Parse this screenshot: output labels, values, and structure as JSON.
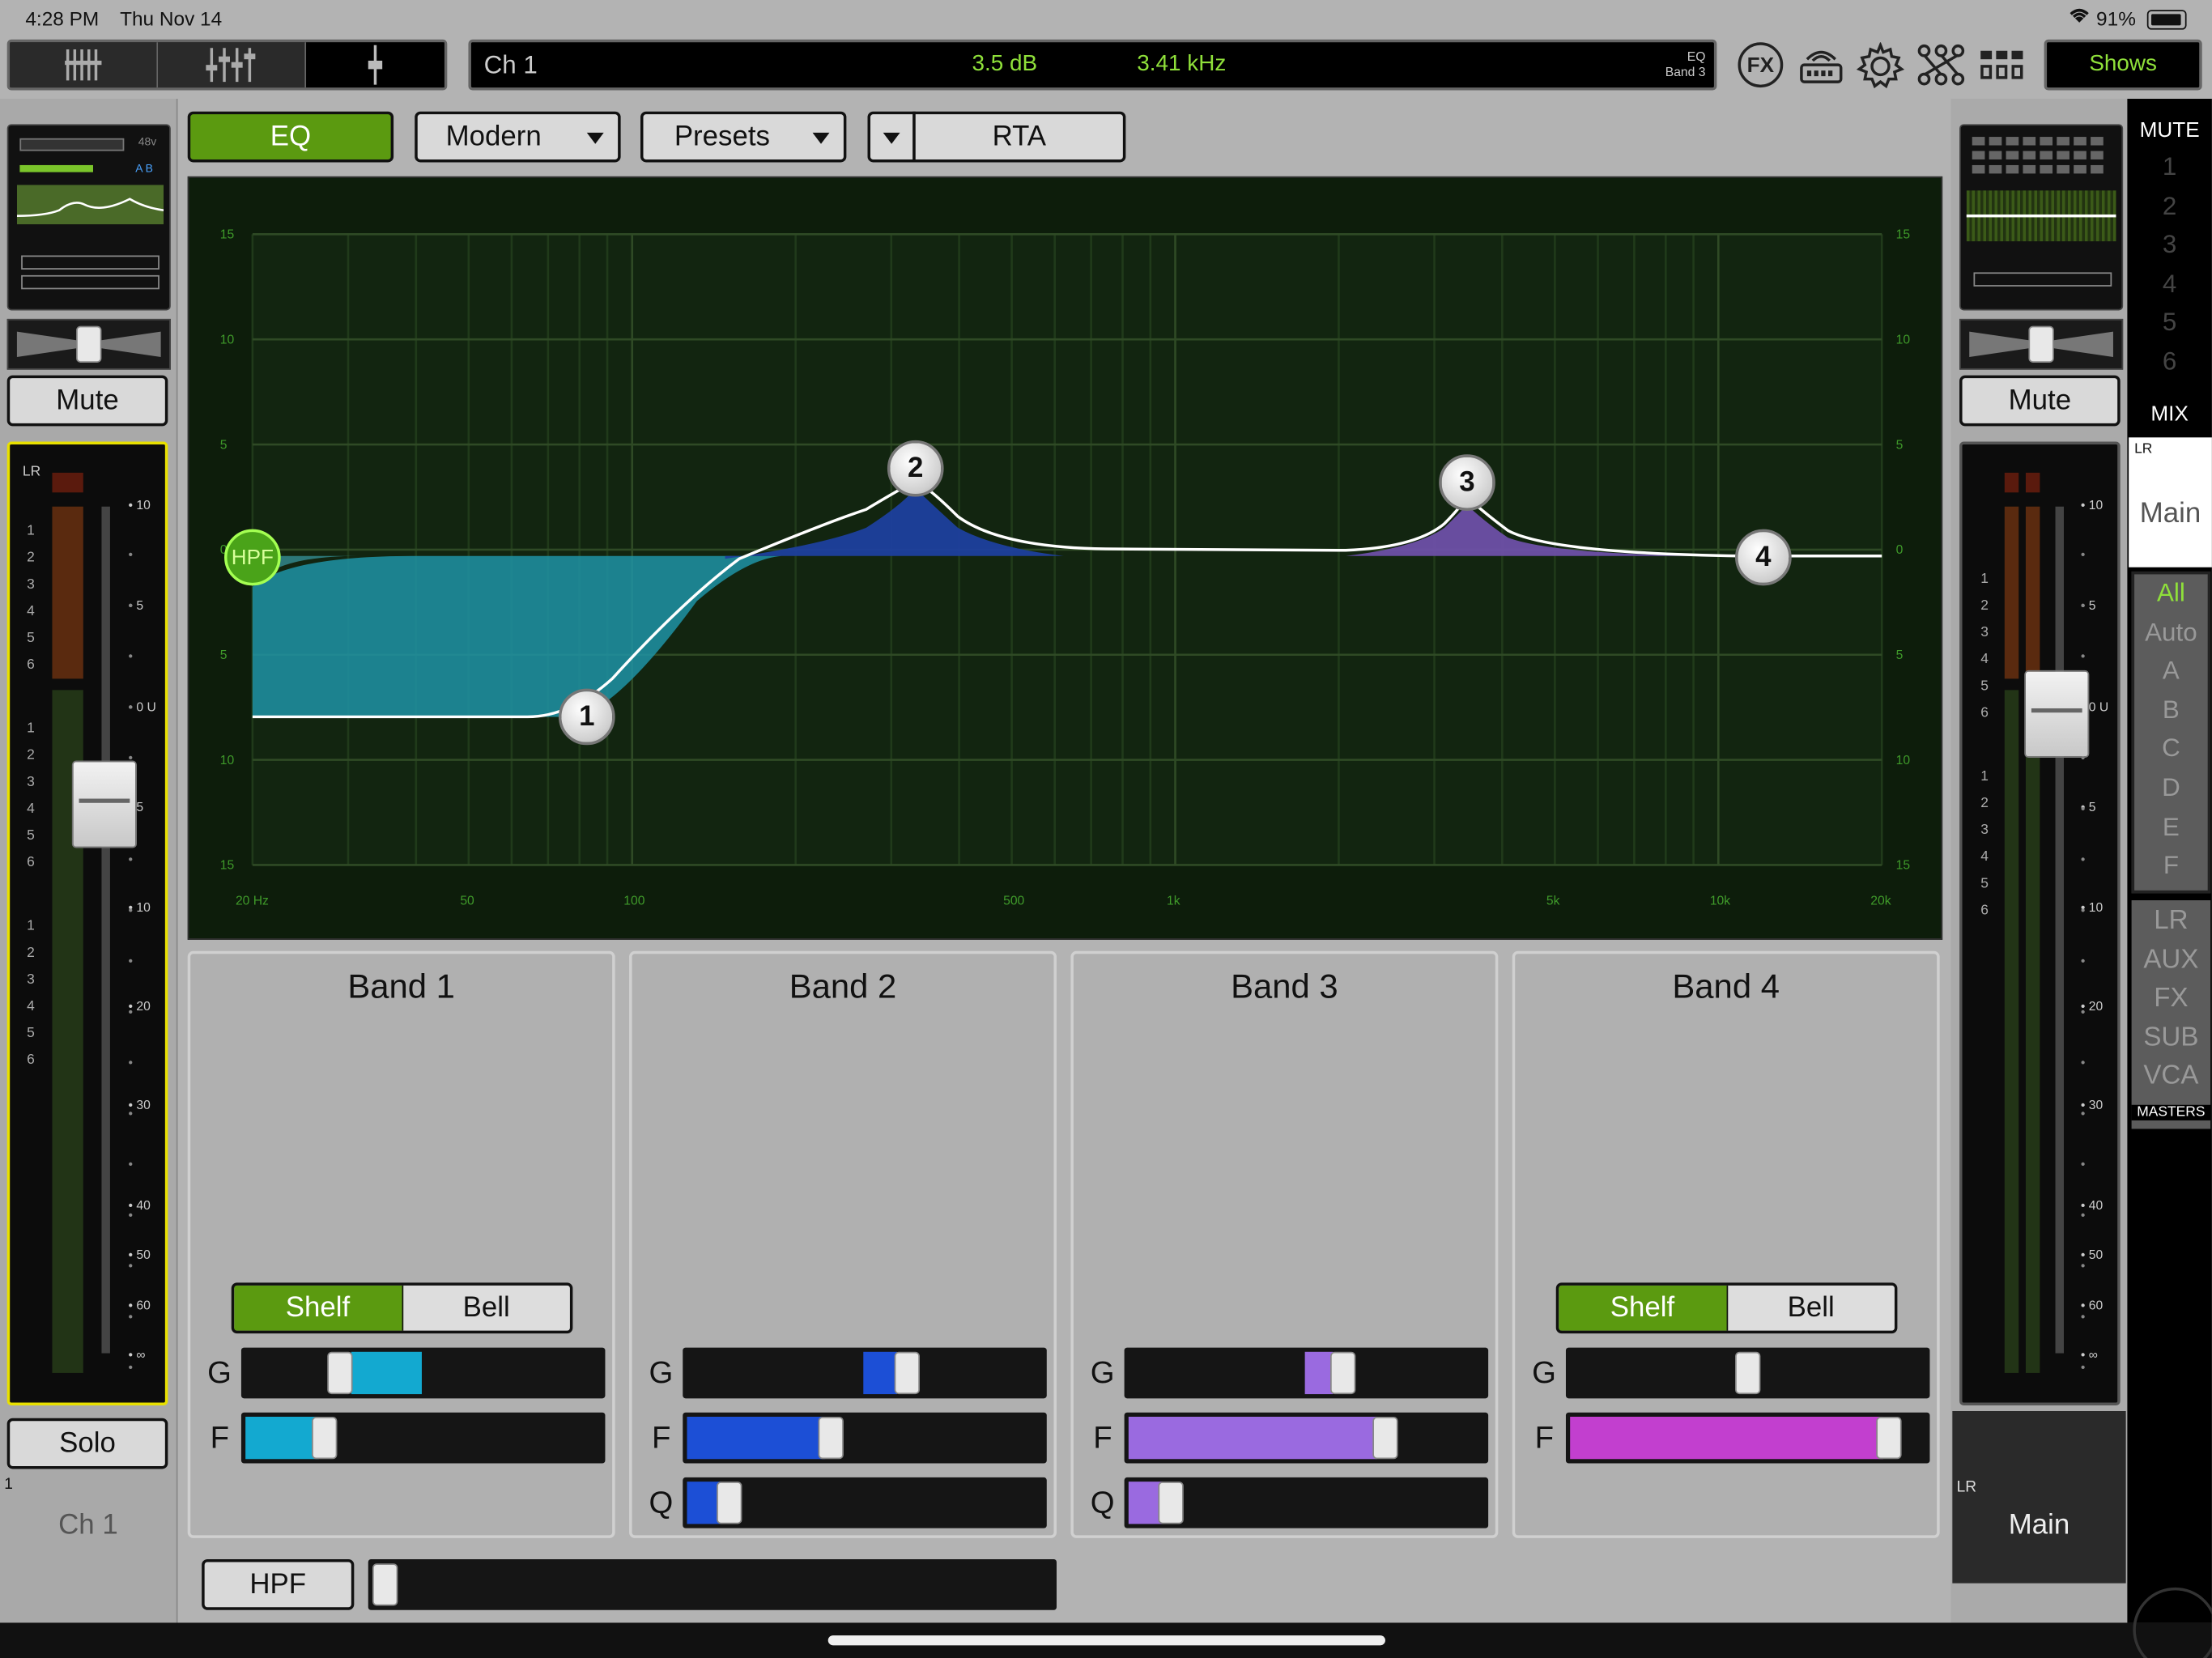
{
  "status": {
    "time": "4:28 PM",
    "date": "Thu Nov 14",
    "battery": "91%"
  },
  "topbar": {
    "channel": "Ch 1",
    "gain": "3.5 dB",
    "freq": "3.41 kHz",
    "info_line1": "EQ",
    "info_line2": "Band 3",
    "fx_label": "FX",
    "shows_label": "Shows"
  },
  "toolbar": {
    "eq": "EQ",
    "mode": "Modern",
    "presets": "Presets",
    "rta": "RTA"
  },
  "graph": {
    "ylabels_left": [
      "15",
      "10",
      "5",
      "0",
      "5",
      "10",
      "15"
    ],
    "ylabels_right": [
      "15",
      "10",
      "5",
      "0",
      "5",
      "10",
      "15"
    ],
    "xlabels": [
      "20 Hz",
      "50",
      "100",
      "500",
      "1k",
      "5k",
      "10k",
      "20k"
    ],
    "hpf_label": "HPF",
    "nodes": [
      "1",
      "2",
      "3",
      "4"
    ]
  },
  "bands": [
    {
      "title": "Band 1",
      "shelf": "Shelf",
      "bell": "Bell",
      "g": "G",
      "f": "F"
    },
    {
      "title": "Band 2",
      "g": "G",
      "f": "F",
      "q": "Q"
    },
    {
      "title": "Band 3",
      "g": "G",
      "f": "F",
      "q": "Q"
    },
    {
      "title": "Band 4",
      "shelf": "Shelf",
      "bell": "Bell",
      "g": "G",
      "f": "F"
    }
  ],
  "hpf_button": "HPF",
  "left_strip": {
    "phantom": "48v",
    "ab": "A  B",
    "mute": "Mute",
    "lr": "LR",
    "scale": [
      "10",
      "5",
      "0 U",
      "5",
      "10",
      "20",
      "30",
      "40",
      "50",
      "60",
      "∞"
    ],
    "solo": "Solo",
    "index": "1",
    "name": "Ch 1"
  },
  "right_strip": {
    "mute": "Mute",
    "lr": "LR",
    "scale": [
      "10",
      "5",
      "0 U",
      "5",
      "10",
      "20",
      "30",
      "40",
      "50",
      "60",
      "∞"
    ],
    "lr_bottom": "LR",
    "main_bottom": "Main"
  },
  "mute_groups": {
    "title": "MUTE",
    "items": [
      "1",
      "2",
      "3",
      "4",
      "5",
      "6"
    ]
  },
  "mix": {
    "title": "MIX",
    "lr": "LR",
    "main": "Main"
  },
  "filters": [
    "All",
    "Auto",
    "A",
    "B",
    "C",
    "D",
    "E",
    "F"
  ],
  "masters": {
    "items": [
      "LR",
      "AUX",
      "FX",
      "SUB",
      "VCA"
    ],
    "label": "MASTERS"
  },
  "colors": {
    "accent_green": "#5b9a10",
    "band1": "#1fa8c9",
    "band2": "#1c4fd6",
    "band3": "#9a6ae0",
    "band4": "#c23fcf",
    "meter_yellow": "#e8e000"
  }
}
